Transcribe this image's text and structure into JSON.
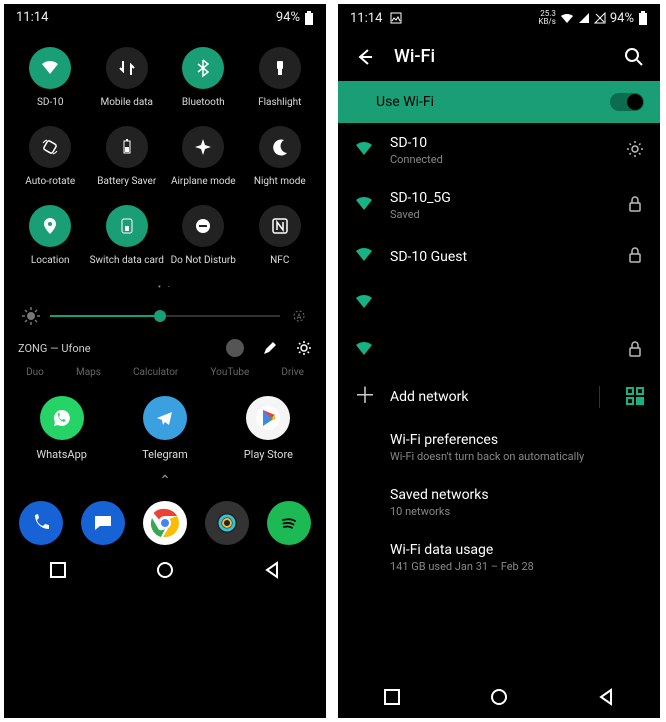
{
  "left": {
    "status": {
      "time": "11:14",
      "battery": "94%"
    },
    "tiles": [
      {
        "label": "SD-10",
        "active": true,
        "icon": "wifi"
      },
      {
        "label": "Mobile data",
        "active": false,
        "icon": "swap"
      },
      {
        "label": "Bluetooth",
        "active": true,
        "icon": "bt"
      },
      {
        "label": "Flashlight",
        "active": false,
        "icon": "flash"
      },
      {
        "label": "Auto-rotate",
        "active": false,
        "icon": "rotate"
      },
      {
        "label": "Battery Saver",
        "active": false,
        "icon": "battery"
      },
      {
        "label": "Airplane mode",
        "active": false,
        "icon": "airplane"
      },
      {
        "label": "Night mode",
        "active": false,
        "icon": "moon"
      },
      {
        "label": "Location",
        "active": true,
        "icon": "location"
      },
      {
        "label": "Switch data card",
        "active": true,
        "icon": "sim"
      },
      {
        "label": "Do Not Disturb",
        "active": false,
        "icon": "dnd"
      },
      {
        "label": "NFC",
        "active": false,
        "icon": "nfc"
      }
    ],
    "footer_carrier": "ZONG — Ufone",
    "faded_row": [
      "Duo",
      "Maps",
      "Calculator",
      "YouTube",
      "Drive"
    ],
    "home_row": [
      {
        "label": "WhatsApp",
        "bg": "#25D366"
      },
      {
        "label": "Telegram",
        "bg": "#3aa0e0"
      },
      {
        "label": "Play Store",
        "bg": "#f5f5f5"
      }
    ]
  },
  "right": {
    "status": {
      "time": "11:14",
      "speed": "25.3",
      "speed_unit": "KB/s",
      "battery": "94%"
    },
    "title": "Wi-Fi",
    "use_wifi": "Use Wi-Fi",
    "networks": [
      {
        "name": "SD-10",
        "sub": "Connected",
        "action": "gear"
      },
      {
        "name": "SD-10_5G",
        "sub": "Saved",
        "action": "lock"
      },
      {
        "name": "SD-10 Guest",
        "sub": "",
        "action": "lock"
      },
      {
        "name": "",
        "sub": "",
        "action": ""
      },
      {
        "name": "",
        "sub": "",
        "action": "lock"
      }
    ],
    "add_network": "Add network",
    "prefs": [
      {
        "name": "Wi-Fi preferences",
        "sub": "Wi-Fi doesn't turn back on automatically"
      },
      {
        "name": "Saved networks",
        "sub": "10 networks"
      },
      {
        "name": "Wi-Fi data usage",
        "sub": "141 GB used Jan 31 – Feb 28"
      }
    ]
  }
}
